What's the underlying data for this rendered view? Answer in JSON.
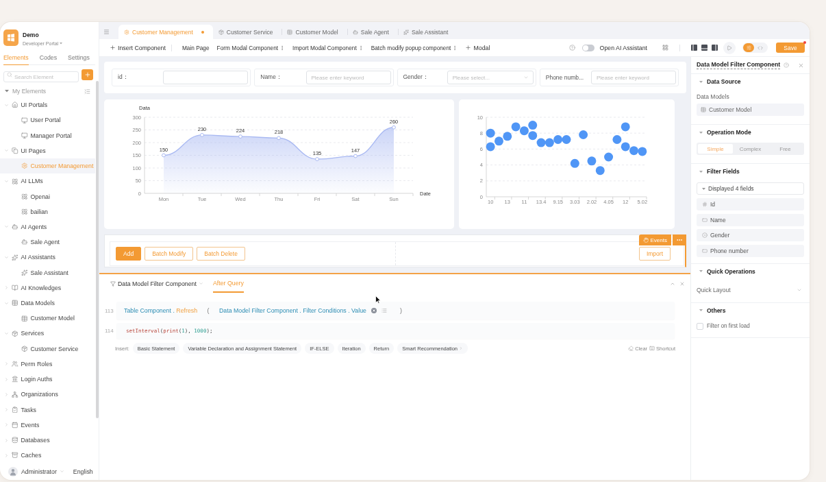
{
  "app": {
    "name": "Demo",
    "portal": "Developer Portal"
  },
  "sidebar": {
    "tabs": [
      {
        "label": "Elements",
        "selected": true
      },
      {
        "label": "Codes",
        "selected": false
      },
      {
        "label": "Settings",
        "selected": false
      }
    ],
    "search": {
      "placeholder": "Search Element"
    },
    "tree": {
      "label": "My Elements",
      "expanded": true,
      "children": [
        {
          "label": "UI Portals",
          "kind": "portal",
          "expanded": true,
          "selected": false,
          "children": [
            {
              "label": "User Portal",
              "kind": "monitor",
              "selected": false
            },
            {
              "label": "Manager Portal",
              "kind": "monitor",
              "selected": false
            }
          ]
        },
        {
          "label": "UI Pages",
          "kind": "pages",
          "expanded": true,
          "selected": false,
          "children": [
            {
              "label": "Customer Management",
              "kind": "page",
              "selected": true
            }
          ]
        },
        {
          "label": "AI LLMs",
          "kind": "llm",
          "expanded": true,
          "selected": false,
          "children": [
            {
              "label": "Openai",
              "kind": "llm",
              "selected": false
            },
            {
              "label": "bailian",
              "kind": "llm",
              "selected": false
            }
          ]
        },
        {
          "label": "AI Agents",
          "kind": "agent",
          "expanded": true,
          "selected": false,
          "children": [
            {
              "label": "Sale Agent",
              "kind": "agent",
              "selected": false
            }
          ]
        },
        {
          "label": "AI Assistants",
          "kind": "assistant",
          "expanded": true,
          "selected": false,
          "children": [
            {
              "label": "Sale Assistant",
              "kind": "assistant",
              "selected": false
            }
          ]
        },
        {
          "label": "AI Knowledges",
          "kind": "knowledge",
          "expanded": false,
          "selected": false
        },
        {
          "label": "Data Models",
          "kind": "model",
          "expanded": true,
          "selected": false,
          "children": [
            {
              "label": "Customer Model",
              "kind": "model",
              "selected": false
            }
          ]
        },
        {
          "label": "Services",
          "kind": "service",
          "expanded": true,
          "selected": false,
          "children": [
            {
              "label": "Customer Service",
              "kind": "service",
              "selected": false
            }
          ]
        },
        {
          "label": "Perm Roles",
          "kind": "role",
          "expanded": false,
          "selected": false
        },
        {
          "label": "Login Auths",
          "kind": "auth",
          "expanded": false,
          "selected": false
        },
        {
          "label": "Organizations",
          "kind": "org",
          "expanded": false,
          "selected": false
        },
        {
          "label": "Tasks",
          "kind": "task",
          "expanded": false,
          "selected": false
        },
        {
          "label": "Events",
          "kind": "event",
          "expanded": false,
          "selected": false
        },
        {
          "label": "Databases",
          "kind": "database",
          "expanded": false,
          "selected": false
        },
        {
          "label": "Caches",
          "kind": "cache",
          "expanded": false,
          "selected": false
        }
      ]
    },
    "user": {
      "name": "Administrator",
      "language": "English"
    }
  },
  "tabs": [
    {
      "label": "Customer Management",
      "kind": "page",
      "selected": true,
      "modified": true
    },
    {
      "label": "Customer Service",
      "kind": "service",
      "selected": false,
      "modified": false
    },
    {
      "label": "Customer Model",
      "kind": "model",
      "selected": false,
      "modified": false
    },
    {
      "label": "Sale Agent",
      "kind": "agent",
      "selected": false,
      "modified": false
    },
    {
      "label": "Sale Assistant",
      "kind": "assistant",
      "selected": false,
      "modified": false
    }
  ],
  "toolbar": {
    "insert": "Insert Component",
    "pages": [
      {
        "label": "Main Page",
        "has_menu": false
      },
      {
        "label": "Form Modal Component",
        "has_menu": true
      },
      {
        "label": "Import Modal Component",
        "has_menu": true
      },
      {
        "label": "Batch modify popup component",
        "has_menu": true
      }
    ],
    "add_modal": "Modal",
    "ai_assistant": {
      "label": "Open AI Assistant",
      "on": false
    },
    "view_modes": [
      {
        "kind": "design",
        "selected": true
      },
      {
        "kind": "code",
        "selected": false
      }
    ],
    "save": {
      "label": "Save",
      "unsaved": true
    }
  },
  "canvas": {
    "filters": [
      {
        "label": "id：",
        "kind": "input"
      },
      {
        "label": "Name：",
        "kind": "input",
        "placeholder": "Please enter keyword"
      },
      {
        "label": "Gender：",
        "kind": "select",
        "placeholder": "Please select..."
      },
      {
        "label": "Phone numb...",
        "kind": "input",
        "placeholder": "Please enter keyword"
      }
    ],
    "line_chart": {
      "chart_data": {
        "type": "area",
        "ylabel": "Data",
        "xlabel": "Date",
        "categories": [
          "Mon",
          "Tue",
          "Wed",
          "Thu",
          "Fri",
          "Sat",
          "Sun"
        ],
        "values": [
          150,
          230,
          224,
          218,
          135,
          147,
          260
        ],
        "color": "#a9b9f2",
        "yticks": [
          0,
          50,
          100,
          150,
          200,
          250,
          300
        ],
        "ylim": [
          0,
          300
        ],
        "data_labels": true,
        "grid": true
      }
    },
    "scatter_chart": {
      "chart_data": {
        "type": "scatter",
        "categories": [
          "10",
          null,
          "13",
          null,
          "11",
          null,
          "13.4",
          null,
          "9.15",
          null,
          "3.03",
          null,
          "2.02",
          null,
          "4.05",
          null,
          "12",
          null,
          "5.02"
        ],
        "series": [
          {
            "color": "#5096f6",
            "values": [
              8.0,
              7.0,
              7.6,
              8.8,
              8.3,
              7.7,
              6.8,
              6.8,
              7.2,
              7.2,
              4.2,
              7.8,
              4.5,
              3.3,
              5.0,
              7.2,
              6.3,
              5.8,
              5.7
            ]
          },
          {
            "color": "#5096f6",
            "values": [
              6.3,
              null,
              null,
              null,
              null,
              9.0,
              null,
              null,
              null,
              null,
              null,
              null,
              null,
              null,
              null,
              null,
              8.8,
              null,
              null
            ]
          }
        ],
        "yticks": [
          0,
          2,
          4,
          6,
          8,
          10
        ],
        "ylim": [
          0,
          10
        ],
        "grid": true
      }
    },
    "table_actions": {
      "buttons": [
        {
          "label": "Add",
          "kind": "primary"
        },
        {
          "label": "Batch Modify",
          "kind": "outline"
        },
        {
          "label": "Batch Delete",
          "kind": "outline"
        }
      ],
      "import": "Import",
      "badge": "Events"
    }
  },
  "code_panel": {
    "component": "Data Model Filter Component",
    "tabs": [
      {
        "label": "After Query",
        "selected": true
      }
    ],
    "lines": [
      {
        "number": "113",
        "kind": "block",
        "tokens": [
          {
            "text": "Table Component .",
            "kind": "ref"
          },
          {
            "text": "Refresh",
            "kind": "method"
          },
          {
            "text": "(",
            "kind": "paren"
          },
          {
            "text": "Data Model Filter Component . Filter Conditions . Value",
            "kind": "ref"
          },
          {
            "kind": "clear"
          },
          {
            "kind": "menu"
          },
          {
            "text": ")",
            "kind": "paren"
          }
        ]
      },
      {
        "number": "114",
        "kind": "code",
        "tokens": [
          {
            "text": "setInterval",
            "kind": "fn"
          },
          {
            "text": "(",
            "kind": "punct"
          },
          {
            "text": "print",
            "kind": "fn"
          },
          {
            "text": "(",
            "kind": "punct"
          },
          {
            "text": "1",
            "kind": "num"
          },
          {
            "text": "), ",
            "kind": "punct"
          },
          {
            "text": "1000",
            "kind": "num"
          },
          {
            "text": ");",
            "kind": "punct"
          }
        ]
      }
    ],
    "insert_label": "Insert:",
    "insert_items": [
      "Basic Statement",
      "Variable Declaration and Assignment Statement",
      "IF-ELSE",
      "Iteration",
      "Return",
      "Smart Recommendation"
    ],
    "clear": "Clear",
    "shortcut": "Shortcut"
  },
  "properties": {
    "title": "Data Model Filter Component",
    "sections": [
      {
        "title": "Data Source",
        "kind": "source",
        "expanded": true,
        "label": "Data Models",
        "value": "Customer Model"
      },
      {
        "title": "Operation Mode",
        "kind": "segmented",
        "expanded": true,
        "options": [
          {
            "label": "Simple",
            "selected": true
          },
          {
            "label": "Complex",
            "selected": false
          },
          {
            "label": "Free",
            "selected": false
          }
        ]
      },
      {
        "title": "Filter Fields",
        "kind": "fields",
        "expanded": true,
        "summary": "Displayed 4 fields",
        "list_expanded": true,
        "fields": [
          {
            "label": "Id",
            "kind": "number"
          },
          {
            "label": "Name",
            "kind": "text"
          },
          {
            "label": "Gender",
            "kind": "radio"
          },
          {
            "label": "Phone number",
            "kind": "text"
          }
        ]
      },
      {
        "title": "Quick Operations",
        "kind": "select",
        "expanded": true,
        "value": "Quick Layout"
      },
      {
        "title": "Others",
        "kind": "checkbox",
        "expanded": true,
        "label": "Filter on first load",
        "checked": false
      }
    ]
  }
}
